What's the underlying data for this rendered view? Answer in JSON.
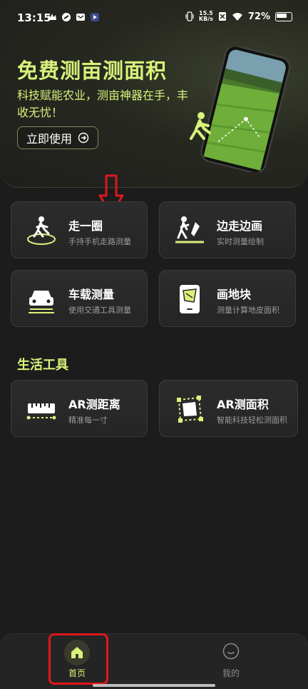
{
  "status_bar": {
    "time": "13:15",
    "net_speed_value": "15.5",
    "net_speed_unit": "KB/s",
    "battery": "72%"
  },
  "hero": {
    "title": "免费测亩测面积",
    "subtitle": "科技赋能农业，测亩神器在手，丰收无忧！",
    "button_label": "立即使用"
  },
  "tools": [
    {
      "title": "走一圈",
      "desc": "手持手机走路测量",
      "icon": "walk-circle-icon"
    },
    {
      "title": "边走边画",
      "desc": "实时测量绘制",
      "icon": "walk-draw-icon"
    },
    {
      "title": "车载测量",
      "desc": "使用交通工具测量",
      "icon": "car-icon"
    },
    {
      "title": "画地块",
      "desc": "测量计算地皮面积",
      "icon": "tablet-map-icon"
    }
  ],
  "life_tools": {
    "section_title": "生活工具",
    "items": [
      {
        "title": "AR测距离",
        "desc": "精准每一寸",
        "icon": "ruler-icon"
      },
      {
        "title": "AR测面积",
        "desc": "智能科技轻松测面积",
        "icon": "area-frame-icon"
      }
    ]
  },
  "bottom_nav": {
    "home_label": "首页",
    "me_label": "我的"
  },
  "colors": {
    "accent": "#d8f27a",
    "background": "#1c1c1c",
    "annotation_red": "#e0161c"
  }
}
